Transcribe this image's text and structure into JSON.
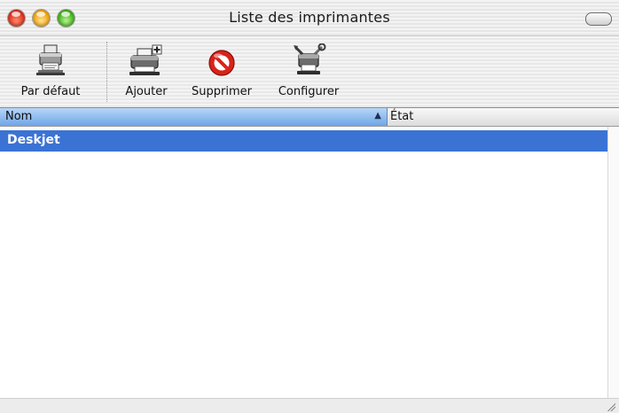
{
  "window": {
    "title": "Liste des imprimantes"
  },
  "toolbar": {
    "items": [
      {
        "label": "Par défaut",
        "icon": "default-printer-icon"
      },
      {
        "label": "Ajouter",
        "icon": "add-printer-icon"
      },
      {
        "label": "Supprimer",
        "icon": "delete-icon"
      },
      {
        "label": "Configurer",
        "icon": "configure-printer-icon"
      }
    ]
  },
  "table": {
    "columns": [
      {
        "label": "Nom",
        "sorted": true,
        "sort_direction": "ascending"
      },
      {
        "label": "État"
      }
    ],
    "rows": [
      {
        "name": "Deskjet",
        "state": "",
        "selected": true
      }
    ]
  },
  "colors": {
    "selection": "#3b73d4",
    "header_sorted": "#8fb8ee",
    "close": "#e0321e",
    "minimize": "#f2a712",
    "zoom": "#44b51f",
    "delete_red": "#d8231a"
  }
}
